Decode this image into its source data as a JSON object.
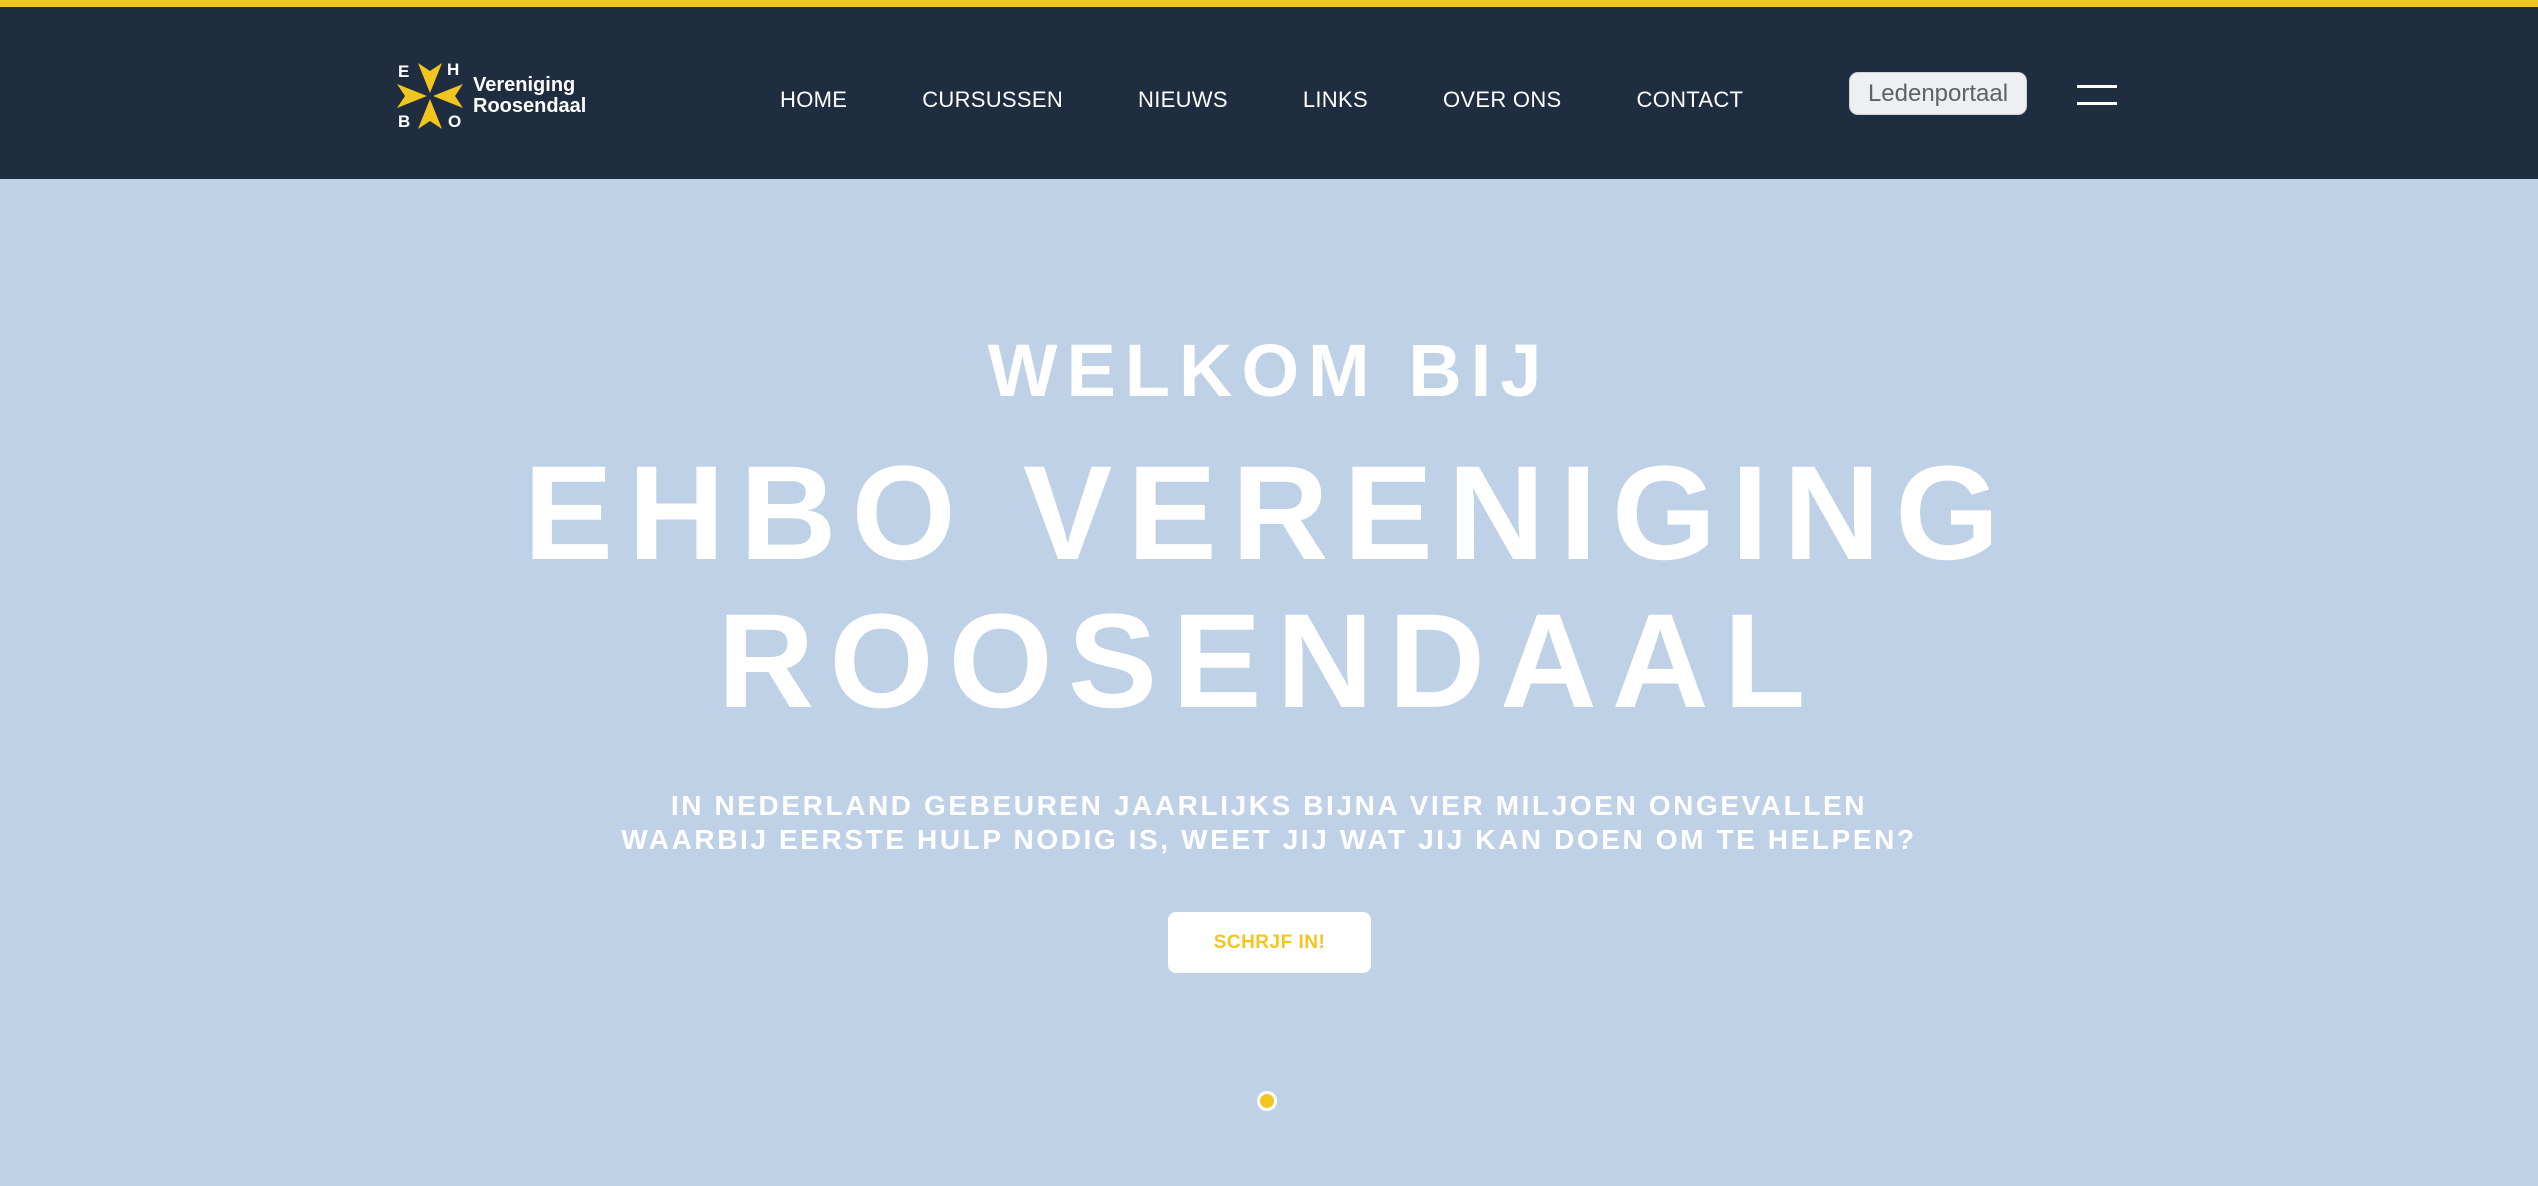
{
  "colors": {
    "top_accent": "#f2c51f",
    "header_bg": "#1e2d3f",
    "hero_bg": "#bfd1e6",
    "brand_yellow": "#f2c51f",
    "text_white": "#ffffff"
  },
  "logo": {
    "icon": "maltese-cross-icon",
    "letters": [
      "E",
      "H",
      "B",
      "O"
    ],
    "line1": "Vereniging",
    "line2": "Roosendaal"
  },
  "nav": {
    "items": [
      {
        "label": "HOME"
      },
      {
        "label": "CURSUSSEN"
      },
      {
        "label": "NIEUWS"
      },
      {
        "label": "LINKS"
      },
      {
        "label": "OVER ONS"
      },
      {
        "label": "CONTACT"
      }
    ]
  },
  "header": {
    "portal_label": "Ledenportaal",
    "menu_icon": "hamburger-menu-icon"
  },
  "hero": {
    "subtitle": "WELKOM BIJ",
    "title_line1": "EHBO VERENIGING",
    "title_line2": "ROOSENDAAL",
    "text_line1": "IN NEDERLAND GEBEUREN JAARLIJKS BIJNA VIER MILJOEN ONGEVALLEN",
    "text_line2": "WAARBIJ EERSTE HULP NODIG IS, WEET JIJ WAT JIJ KAN DOEN OM TE HELPEN?",
    "cta_label": "SCHRJF IN!",
    "slide_count": 1,
    "active_slide": 1
  }
}
